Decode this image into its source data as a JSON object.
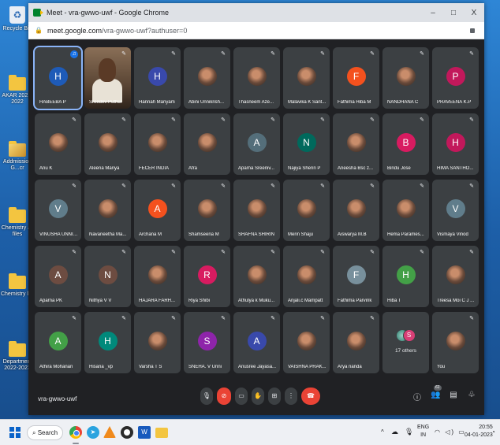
{
  "desktop": {
    "icons": [
      {
        "label": "Recycle Bin"
      },
      {
        "label": "AKAR 2021-2022"
      },
      {
        "label": "Addmission G...cr"
      },
      {
        "label": "Chemistry all files"
      },
      {
        "label": "Chemistry list"
      },
      {
        "label": "Department 2022-2023"
      }
    ]
  },
  "browser": {
    "title": "Meet - vra-gwwo-uwf - Google Chrome",
    "url_host": "meet.google.com",
    "url_path": "/vra-gwwo-uwf?authuser=0",
    "controls": {
      "minimize": "–",
      "maximize": "□",
      "close": "X"
    }
  },
  "meet": {
    "code": "vra-gwwo-uwf",
    "participants": [
      {
        "name": "HABEEBA P",
        "initial": "H",
        "color": "#1e5bb8",
        "speaking": true
      },
      {
        "name": "Sreedev Puthur",
        "video": true
      },
      {
        "name": "Hannah Mariyam",
        "initial": "H",
        "color": "#3949ab"
      },
      {
        "name": "Abini Unnikrish...",
        "photo": true
      },
      {
        "name": "Thasneem Aze...",
        "photo": true
      },
      {
        "name": "Malavika K Sant...",
        "photo": true
      },
      {
        "name": "Fathima Hiba M",
        "initial": "F",
        "color": "#f4511e"
      },
      {
        "name": "NANDHANA C",
        "photo": true
      },
      {
        "name": "PRAVEENA K.P",
        "initial": "P",
        "color": "#c2185b"
      },
      {
        "name": "Anu K",
        "photo": true
      },
      {
        "name": "Aleena Mariya",
        "photo": true
      },
      {
        "name": "FECER INDIA",
        "photo": true
      },
      {
        "name": "Afra",
        "photo": true
      },
      {
        "name": "Aparna Sreeniv...",
        "initial": "A",
        "color": "#546e7a"
      },
      {
        "name": "Najiya Sherin P",
        "initial": "N",
        "color": "#00695c"
      },
      {
        "name": "Aneesha Bsc z...",
        "photo": true
      },
      {
        "name": "Bindu Jose",
        "initial": "B",
        "color": "#d81b60"
      },
      {
        "name": "HIMA SANTHO...",
        "initial": "H",
        "color": "#c2185b"
      },
      {
        "name": "VINUSHA UNNI ...",
        "initial": "V",
        "color": "#607d8b"
      },
      {
        "name": "Navaneetha Ma...",
        "photo": true
      },
      {
        "name": "Archana M",
        "initial": "A",
        "color": "#f4511e"
      },
      {
        "name": "Shamseena M",
        "photo": true
      },
      {
        "name": "SHAFNA SHIRIN",
        "photo": true
      },
      {
        "name": "Merin Shaju",
        "photo": true
      },
      {
        "name": "Aiswarya M.B",
        "photo": true
      },
      {
        "name": "Hema Parames...",
        "photo": true
      },
      {
        "name": "Vismaya Vinod",
        "initial": "V",
        "color": "#607d8b"
      },
      {
        "name": "Aparna PK",
        "initial": "A",
        "color": "#6d4c41"
      },
      {
        "name": "Nithya V V",
        "initial": "N",
        "color": "#6d4c41"
      },
      {
        "name": "HAJARA FARH...",
        "photo": true
      },
      {
        "name": "Riya Shibi",
        "initial": "R",
        "color": "#d81b60"
      },
      {
        "name": "Athulya k Muku...",
        "photo": true
      },
      {
        "name": "Anjali.c Mampatt",
        "photo": true
      },
      {
        "name": "Fathima Parvink",
        "initial": "F",
        "color": "#78909c"
      },
      {
        "name": "Hiba T",
        "initial": "H",
        "color": "#43a047"
      },
      {
        "name": "Treesa Moi C J ...",
        "photo": true
      },
      {
        "name": "Athira Mohanan",
        "initial": "A",
        "color": "#43a047"
      },
      {
        "name": "Hisana _vp",
        "initial": "H",
        "color": "#00897b"
      },
      {
        "name": "Varsha T S",
        "photo": true
      },
      {
        "name": "SNEHA. V Unni",
        "initial": "S",
        "color": "#8e24aa"
      },
      {
        "name": "Anusree Jayasa...",
        "initial": "A",
        "color": "#3949ab"
      },
      {
        "name": "VAISHNA PRAK...",
        "photo": true
      },
      {
        "name": "Arya nanda",
        "photo": true
      },
      {
        "name": "17 others",
        "others": true
      },
      {
        "name": "You",
        "photo": true
      }
    ],
    "others_initial": "S",
    "people_count": "61",
    "toolbar": {
      "mic": "🎙",
      "cam": "⊘",
      "cc": "▭",
      "hand": "✋",
      "present": "⊞",
      "more": "⋮",
      "end": "☎"
    },
    "right_toolbar": {
      "info": "ⓘ",
      "people": "👥",
      "chat": "▤",
      "activities": "♧"
    }
  },
  "taskbar": {
    "search_label": "Search",
    "tg_glyph": "➤",
    "word_glyph": "W",
    "lang_top": "ENG",
    "lang_bottom": "IN",
    "tray_icons": "◠ ◁) ▭",
    "time": "20:55",
    "date": "04-01-2023"
  }
}
